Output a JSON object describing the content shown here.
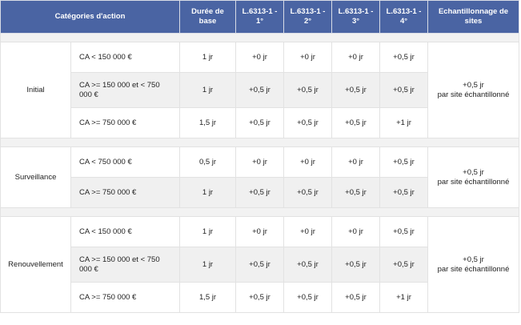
{
  "header": {
    "categories": "Catégories d'action",
    "duree": "Durée de base",
    "l1": "L.6313-1 - 1°",
    "l2": "L.6313-1 - 2°",
    "l3": "L.6313-1 - 3°",
    "l4": "L.6313-1 - 4°",
    "echantillonnage": "Echantillonnage de sites"
  },
  "groups": [
    {
      "name": "Initial",
      "sites": [
        "+0,5 jr",
        "par site échantillonné"
      ],
      "rows": [
        {
          "ca": "CA < 150 000 €",
          "duree": "1 jr",
          "l1": "+0 jr",
          "l2": "+0 jr",
          "l3": "+0 jr",
          "l4": "+0,5 jr"
        },
        {
          "ca": "CA >= 150 000 et < 750 000 €",
          "duree": "1 jr",
          "l1": "+0,5 jr",
          "l2": "+0,5 jr",
          "l3": "+0,5 jr",
          "l4": "+0,5 jr"
        },
        {
          "ca": "CA >= 750 000 €",
          "duree": "1,5 jr",
          "l1": "+0,5 jr",
          "l2": "+0,5 jr",
          "l3": "+0,5 jr",
          "l4": "+1 jr"
        }
      ]
    },
    {
      "name": "Surveillance",
      "sites": [
        "+0,5 jr",
        "par site échantillonné"
      ],
      "rows": [
        {
          "ca": "CA < 750 000 €",
          "duree": "0,5 jr",
          "l1": "+0 jr",
          "l2": "+0 jr",
          "l3": "+0 jr",
          "l4": "+0,5 jr"
        },
        {
          "ca": "CA >= 750 000 €",
          "duree": "1 jr",
          "l1": "+0,5 jr",
          "l2": "+0,5 jr",
          "l3": "+0,5 jr",
          "l4": "+0,5 jr"
        }
      ]
    },
    {
      "name": "Renouvellement",
      "sites": [
        "+0,5 jr",
        "par site échantillonné"
      ],
      "rows": [
        {
          "ca": "CA < 150 000 €",
          "duree": "1 jr",
          "l1": "+0 jr",
          "l2": "+0 jr",
          "l3": "+0 jr",
          "l4": "+0,5 jr"
        },
        {
          "ca": "CA >= 150 000 et < 750 000 €",
          "duree": "1 jr",
          "l1": "+0,5 jr",
          "l2": "+0,5 jr",
          "l3": "+0,5 jr",
          "l4": "+0,5 jr"
        },
        {
          "ca": "CA >= 750 000 €",
          "duree": "1,5 jr",
          "l1": "+0,5 jr",
          "l2": "+0,5 jr",
          "l3": "+0,5 jr",
          "l4": "+1 jr"
        }
      ]
    }
  ]
}
